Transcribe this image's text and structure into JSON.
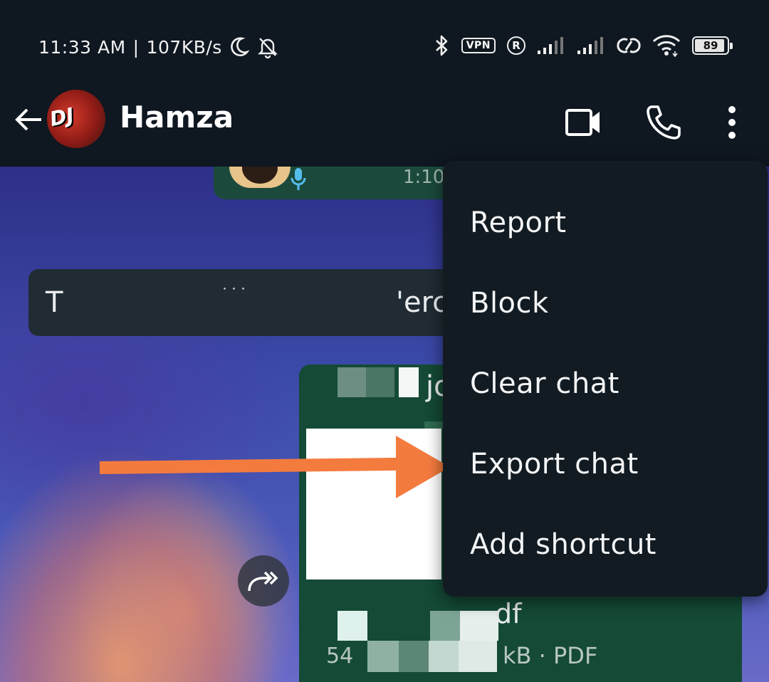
{
  "status_bar": {
    "time": "11:33 AM",
    "separator": "|",
    "speed": "107KB/s",
    "vpn_label": "VPN",
    "registered_label": "R",
    "battery_level": "89",
    "icons": [
      "moon-icon",
      "bell-off-icon",
      "bluetooth-icon",
      "vpn-icon",
      "registered-icon",
      "signal-icon",
      "signal-icon",
      "hotspot-icon",
      "wifi-icon",
      "battery-icon"
    ]
  },
  "header": {
    "contact_name": "Hamza",
    "avatar_text": "DJ",
    "icons": [
      "back-arrow-icon",
      "video-call-icon",
      "phone-icon",
      "more-vert-icon"
    ]
  },
  "chat": {
    "voice_message_time": "1:10",
    "incoming_text_start": "T",
    "incoming_text_dots": "˙˙˙",
    "incoming_text_end": "'erc",
    "document_name_fragment": "jo",
    "pdf_name_fragment": "df",
    "pdf_size_fragment": "54",
    "pdf_meta": "kB · PDF"
  },
  "menu": {
    "items": [
      {
        "label": "Report"
      },
      {
        "label": "Block"
      },
      {
        "label": "Clear chat"
      },
      {
        "label": "Export chat"
      },
      {
        "label": "Add shortcut"
      }
    ]
  },
  "colors": {
    "bg_dark": "#0f1720",
    "menu_bg": "#121b22",
    "outgoing_bubble": "#144a36",
    "incoming_bubble": "#202b33",
    "annotation_arrow": "#f47b3e"
  }
}
